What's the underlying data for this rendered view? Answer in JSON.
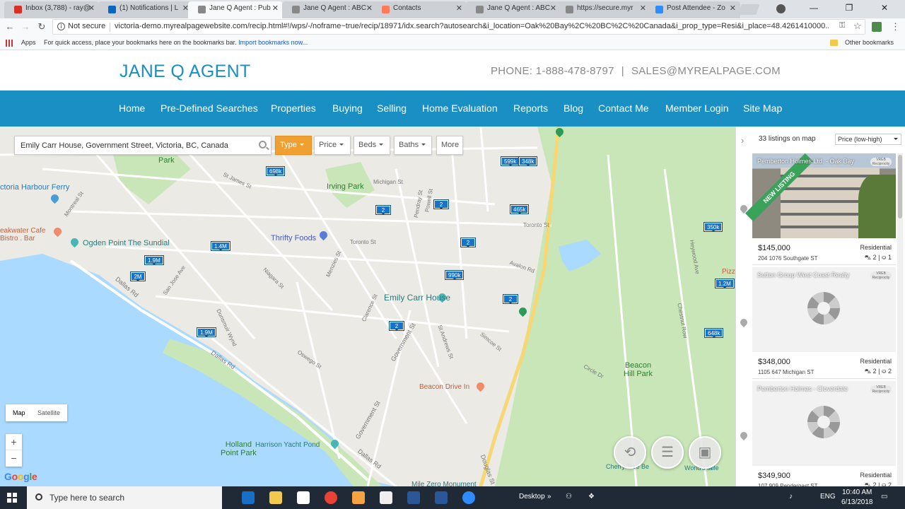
{
  "browser": {
    "tabs": [
      {
        "label": "Inbox (3,788) - ray@",
        "icon": "gmail-icon",
        "color": "#d93025"
      },
      {
        "label": "(1) Notifications | L",
        "icon": "linkedin-icon",
        "color": "#0a66c2"
      },
      {
        "label": "Jane Q Agent : Pub",
        "icon": "page-icon",
        "color": "#888888"
      },
      {
        "label": "Jane Q Agent : ABC",
        "icon": "page-icon",
        "color": "#888888"
      },
      {
        "label": "Contacts",
        "icon": "hubspot-icon",
        "color": "#ff7a59"
      },
      {
        "label": "Jane Q Agent : ABC",
        "icon": "page-icon",
        "color": "#888888"
      },
      {
        "label": "https://secure.myr",
        "icon": "page-icon",
        "color": "#888888"
      },
      {
        "label": "Post Attendee - Zo",
        "icon": "zoom-icon",
        "color": "#2d8cff"
      }
    ],
    "active_tab": 2,
    "security_label": "Not secure",
    "url": "victoria-demo.myrealpagewebsite.com/recip.html#!/wps/-/noframe~true/recip/18971/idx.search?autosearch&i_location=Oak%20Bay%2C%20BC%2C%20Canada&i_prop_type=Resi&i_place=48.4261410000...",
    "bookmarks": {
      "apps_label": "Apps",
      "hint_text": "For quick access, place your bookmarks here on the bookmarks bar.",
      "import_link": "Import bookmarks now...",
      "other_label": "Other bookmarks"
    }
  },
  "site": {
    "brand": "JANE Q AGENT",
    "phone": "PHONE: 1-888-478-8797",
    "separator": "|",
    "email": "SALES@MYREALPAGE.COM",
    "nav": [
      "Home",
      "Pre-Defined Searches",
      "Properties",
      "Buying",
      "Selling",
      "Home Evaluation",
      "Reports",
      "Blog",
      "Contact Me",
      "Member Login",
      "Site Map"
    ],
    "brand_color": "#1a8fc4"
  },
  "search": {
    "value": "Emily Carr House, Government Street, Victoria, BC, Canada",
    "filters": [
      "Type",
      "Price",
      "Beds",
      "Baths",
      "More"
    ],
    "active_filter": "Type"
  },
  "map": {
    "labels": {
      "park": "Park",
      "irving_park": "Irving Park",
      "victoria_harbour_ferry": "ctoria Harbour Ferry",
      "breakwater_cafe": "eakwater Cafe\nBistro . Bar",
      "ogden_point": "Ogden Point The Sundial",
      "thrifty_foods": "Thrifty Foods",
      "emily_carr_house": "Emily Carr House",
      "beacon_drive_in": "Beacon Drive In",
      "beacon_hill_park": "Beacon\nHill Park",
      "holland_point_park": "Holland\nPoint Park",
      "harrison_yacht_pond": "Harrison Yacht Pond",
      "mile_zero": "Mile Zero Monument",
      "pizza": "Pizz",
      "cherry_tree": "Cherry Tree Be",
      "worlds_tallest": "World's talle",
      "dallas_rd": "Dallas Rd",
      "government_st": "Government St",
      "douglas_st": "Douglas St",
      "michigan_st": "Michigan St",
      "toronto_st": "Toronto St",
      "avalon_rd": "Avalon Rd",
      "niagara_st": "Niagara St",
      "simcoe_st": "Simcoe St",
      "st_andrews_st": "St Andrews St",
      "san_jose_ave": "San Jose Ave",
      "dunsmuir_wynd": "Dunsmuir Wynd",
      "montreal_st": "Montreal St",
      "st_james_st": "St James St",
      "menzies_st": "Menzies St",
      "clarence_st": "Clarence St",
      "oswego_st": "Oswego St",
      "pendray_st": "Pendray St",
      "powell_st": "Powell St",
      "chestnut_row": "Chestnut Row",
      "circle_dr": "Circle Dr",
      "heywood_ave": "Heywood Ave"
    },
    "pins": [
      {
        "label": "698k"
      },
      {
        "label": "599k"
      },
      {
        "label": "348k"
      },
      {
        "label": "2"
      },
      {
        "label": "2"
      },
      {
        "label": "465k"
      },
      {
        "label": "350k"
      },
      {
        "label": "1.4M"
      },
      {
        "label": "2"
      },
      {
        "label": "1.9M"
      },
      {
        "label": "2M"
      },
      {
        "label": "990k"
      },
      {
        "label": "2"
      },
      {
        "label": "1.2M"
      },
      {
        "label": "2"
      },
      {
        "label": "1.9M"
      },
      {
        "label": "648k"
      }
    ],
    "map_type": {
      "map": "Map",
      "satellite": "Satellite"
    },
    "zoom": {
      "in": "+",
      "out": "−"
    },
    "google_logo": "Google"
  },
  "listings": {
    "count_label": "33 listings on map",
    "sort_label": "Price (low-high)",
    "cards": [
      {
        "broker": "Pemberton Holmes Ltd. - Oak Bay",
        "badge": "VREB Reciprocity",
        "ribbon": "NEW LISTING",
        "price": "$145,000",
        "address": "204 1076 Southgate ST",
        "type": "Residential",
        "beds": "2",
        "baths": "1",
        "has_photo": true
      },
      {
        "broker": "Sutton Group West Coast Realty",
        "badge": "VREB Reciprocity",
        "ribbon": "",
        "price": "$348,000",
        "address": "1105 647 Michigan ST",
        "type": "Residential",
        "beds": "2",
        "baths": "2",
        "has_photo": false
      },
      {
        "broker": "Pemberton Holmes - Cloverdale",
        "badge": "VREB Reciprocity",
        "ribbon": "",
        "price": "$349,900",
        "address": "107 909 Pendergast ST",
        "type": "Residential",
        "beds": "2",
        "baths": "2",
        "has_photo": false
      }
    ]
  },
  "taskbar": {
    "search_placeholder": "Type here to search",
    "desktop_label": "Desktop",
    "language": "ENG",
    "time": "10:40 AM",
    "date": "6/13/2018"
  },
  "window": {
    "minimize": "—",
    "restore": "❐",
    "close": "✕"
  }
}
